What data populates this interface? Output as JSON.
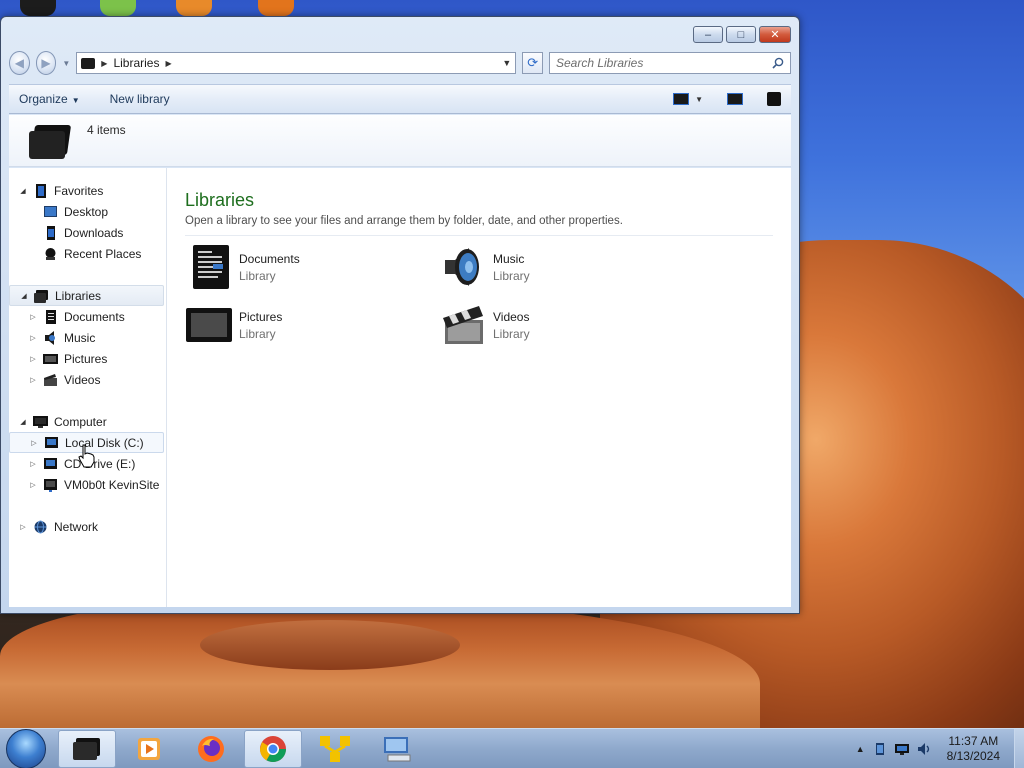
{
  "window": {
    "controls": {
      "minimize": "–",
      "maximize": "□",
      "close": "✕"
    },
    "address": {
      "root_icon": "libraries-icon",
      "segments": [
        "Libraries"
      ]
    },
    "search": {
      "placeholder": "Search Libraries",
      "value": ""
    }
  },
  "toolbar": {
    "organize": "Organize",
    "new_library": "New library"
  },
  "details": {
    "count": "4 items"
  },
  "nav": {
    "favorites": {
      "label": "Favorites",
      "items": [
        {
          "label": "Desktop",
          "icon": "desktop-icon"
        },
        {
          "label": "Downloads",
          "icon": "downloads-icon"
        },
        {
          "label": "Recent Places",
          "icon": "recent-places-icon"
        }
      ]
    },
    "libraries": {
      "label": "Libraries",
      "items": [
        {
          "label": "Documents",
          "icon": "documents-icon"
        },
        {
          "label": "Music",
          "icon": "music-icon"
        },
        {
          "label": "Pictures",
          "icon": "pictures-icon"
        },
        {
          "label": "Videos",
          "icon": "videos-icon"
        }
      ]
    },
    "computer": {
      "label": "Computer",
      "items": [
        {
          "label": "Local Disk (C:)",
          "icon": "local-disk-icon"
        },
        {
          "label": "CD Drive (E:)",
          "icon": "cd-drive-icon"
        },
        {
          "label": "VM0b0t KevinSite",
          "icon": "network-drive-icon"
        }
      ]
    },
    "network": {
      "label": "Network"
    }
  },
  "main": {
    "title": "Libraries",
    "description": "Open a library to see your files and arrange them by folder, date, and other properties.",
    "libraries": [
      {
        "name": "Documents",
        "type": "Library",
        "icon": "documents-library-icon"
      },
      {
        "name": "Music",
        "type": "Library",
        "icon": "music-library-icon"
      },
      {
        "name": "Pictures",
        "type": "Library",
        "icon": "pictures-library-icon"
      },
      {
        "name": "Videos",
        "type": "Library",
        "icon": "videos-library-icon"
      }
    ]
  },
  "taskbar": {
    "apps": [
      "windows-explorer-icon",
      "media-player-icon",
      "firefox-icon",
      "chrome-icon",
      "network-app-icon",
      "remote-desktop-icon"
    ],
    "clock": {
      "time": "11:37 AM",
      "date": "8/13/2024"
    }
  },
  "colors": {
    "title_green": "#1e6e1e",
    "accent": "#2e6bc8"
  }
}
